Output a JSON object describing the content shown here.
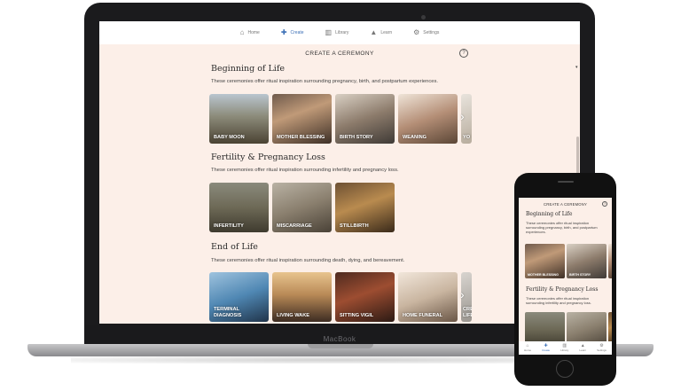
{
  "laptop": {
    "brand": "MacBook",
    "nav": [
      {
        "icon": "⌂",
        "label": "Home"
      },
      {
        "icon": "✚",
        "label": "Create"
      },
      {
        "icon": "▥",
        "label": "Library"
      },
      {
        "icon": "▲",
        "label": "Learn"
      },
      {
        "icon": "⚙",
        "label": "Settings"
      }
    ],
    "page_title": "CREATE A CEREMONY",
    "help": "?",
    "sections": [
      {
        "title": "Beginning of Life",
        "desc": "These ceremonies offer ritual inspiration surrounding pregnancy, birth, and postpartum experiences.",
        "cards": [
          "BABY MOON",
          "MOTHER BLESSING",
          "BIRTH STORY",
          "WEANING",
          "YO"
        ]
      },
      {
        "title": "Fertility & Pregnancy Loss",
        "desc": "These ceremonies offer ritual inspiration surrounding infertility and pregnancy loss.",
        "cards": [
          "INFERTILITY",
          "MISCARRIAGE",
          "STILLBIRTH"
        ]
      },
      {
        "title": "End of Life",
        "desc": "These ceremonies offer ritual inspiration surrounding death, dying, and bereavement.",
        "cards": [
          "TERMINAL DIAGNOSIS",
          "LIVING WAKE",
          "SITTING VIGIL",
          "HOME FUNERAL",
          "CRE LIFE"
        ]
      }
    ]
  },
  "phone": {
    "page_title": "CREATE A CEREMONY",
    "help": "?",
    "sections": [
      {
        "title": "Beginning of Life",
        "desc": "These ceremonies offer ritual inspiration surrounding pregnancy, birth, and postpartum experiences.",
        "cards": [
          "MOTHER BLESSING",
          "BIRTH STORY"
        ]
      },
      {
        "title": "Fertility & Pregnancy Loss",
        "desc": "These ceremonies offer ritual inspiration surrounding infertility and pregnancy loss."
      }
    ],
    "tabs": [
      {
        "icon": "⌂",
        "label": "Home"
      },
      {
        "icon": "✚",
        "label": "Create"
      },
      {
        "icon": "▥",
        "label": "Library"
      },
      {
        "icon": "▲",
        "label": "Learn"
      },
      {
        "icon": "⚙",
        "label": "Settings"
      }
    ]
  },
  "colors": {
    "page_bg": "#fcefe8",
    "accent": "#3b6fb6",
    "device_frame": "#1b1b1d"
  }
}
